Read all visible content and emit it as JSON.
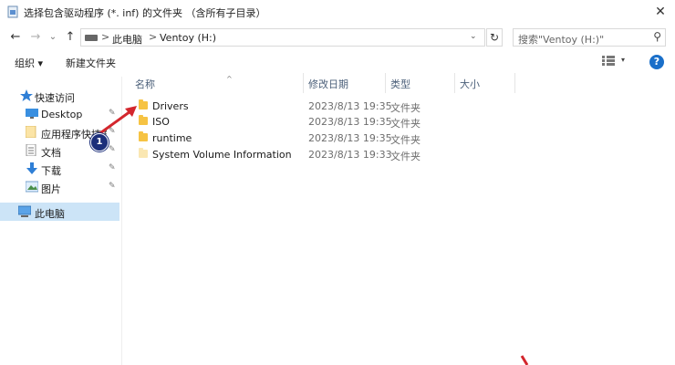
{
  "window": {
    "title": "选择包含驱动程序 (*. inf) 的文件夹 （含所有子目录）",
    "close_glyph": "✕"
  },
  "nav": {
    "back_glyph": "←",
    "forward_glyph": "→",
    "recent_glyph": "⌄",
    "up_glyph": "↑",
    "breadcrumb": [
      "此电脑",
      "Ventoy (H:)"
    ],
    "separator": ">",
    "dropdown_glyph": "⌄",
    "refresh_glyph": "↻",
    "search_placeholder": "搜索\"Ventoy (H:)\"",
    "search_glyph": "⚲"
  },
  "toolbar": {
    "organize_label": "组织 ▾",
    "new_folder_label": "新建文件夹",
    "help_label": "?",
    "view_arrow_glyph": "▾"
  },
  "sidebar": {
    "items": [
      {
        "label": "快速访问",
        "icon": "star-icon",
        "pinned": false
      },
      {
        "label": "Desktop",
        "icon": "desktop-icon",
        "pinned": true
      },
      {
        "label": "应用程序快捷方",
        "icon": "folder-icon",
        "pinned": true
      },
      {
        "label": "文档",
        "icon": "document-icon",
        "pinned": true
      },
      {
        "label": "下载",
        "icon": "download-icon",
        "pinned": true
      },
      {
        "label": "图片",
        "icon": "picture-icon",
        "pinned": true
      },
      {
        "label": "此电脑",
        "icon": "computer-icon",
        "pinned": false,
        "selected": true
      }
    ],
    "pin_glyph": "📌"
  },
  "file_list": {
    "columns": [
      "名称",
      "修改日期",
      "类型",
      "大小"
    ],
    "sort_glyph": "^",
    "rows": [
      {
        "name": "Drivers",
        "date": "2023/8/13 19:35",
        "type": "文件夹"
      },
      {
        "name": "ISO",
        "date": "2023/8/13 19:35",
        "type": "文件夹"
      },
      {
        "name": "runtime",
        "date": "2023/8/13 19:35",
        "type": "文件夹"
      },
      {
        "name": "System Volume Information",
        "date": "2023/8/13 19:33",
        "type": "文件夹"
      }
    ]
  },
  "annotation": {
    "badge_number": "1",
    "color": "#d3262d"
  },
  "colors": {
    "selection": "#cce4f7",
    "folder": "#f6c343",
    "help": "#1a6fc9",
    "badge": "#1c2f7a"
  }
}
